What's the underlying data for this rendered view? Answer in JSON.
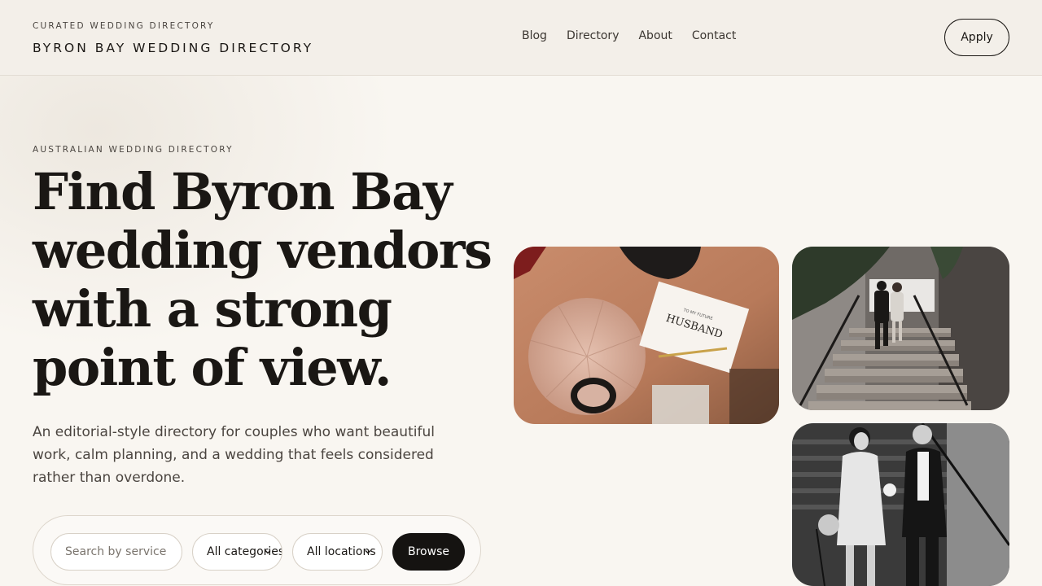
{
  "header": {
    "kicker": "CURATED WEDDING DIRECTORY",
    "title": "BYRON BAY WEDDING DIRECTORY",
    "nav": [
      {
        "label": "Blog"
      },
      {
        "label": "Directory"
      },
      {
        "label": "About"
      },
      {
        "label": "Contact"
      }
    ],
    "apply_label": "Apply"
  },
  "hero": {
    "kicker": "AUSTRALIAN WEDDING DIRECTORY",
    "headline": "Find Byron Bay wedding vendors with a strong point of view.",
    "lede": "An editorial-style directory for couples who want beautiful work, calm planning, and a wedding that feels considered rather than overdone."
  },
  "search": {
    "placeholder": "Search by service",
    "category_value": "All categories",
    "location_value": "All locations",
    "browse_label": "Browse"
  },
  "photos": {
    "card_text_top": "TO MY FUTURE",
    "card_text_main": "HUSBAND"
  },
  "colors": {
    "background": "#f9f6f1",
    "header_bg": "#f3efe9",
    "ink": "#1a1714",
    "button_dark": "#151311"
  }
}
